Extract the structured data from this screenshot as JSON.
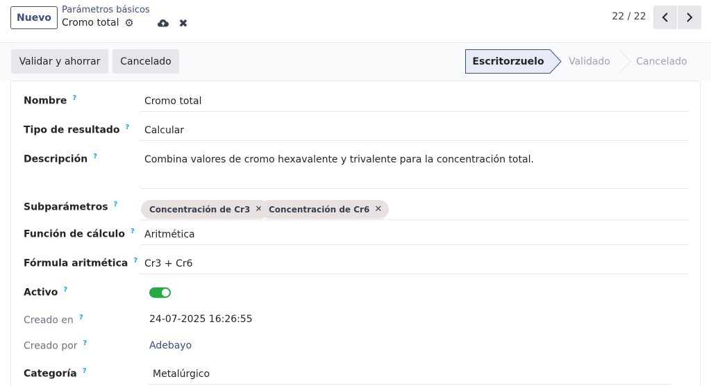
{
  "control_panel": {
    "new_button": "Nuevo",
    "breadcrumb_parent": "Parámetros básicos",
    "breadcrumb_current": "Cromo total",
    "pager_value": "22 / 22"
  },
  "statusbar": {
    "actions": [
      "Validar y ahorrar",
      "Cancelado"
    ],
    "stages": [
      "Escritorzuelo",
      "Validado",
      "Cancelado"
    ],
    "active_stage": "Escritorzuelo"
  },
  "form": {
    "help_mark": "?",
    "nombre": {
      "label": "Nombre",
      "value": "Cromo total"
    },
    "tipo_resultado": {
      "label": "Tipo de resultado",
      "value": "Calcular"
    },
    "descripcion": {
      "label": "Descripción",
      "value": "Combina valores de cromo hexavalente y trivalente para la concentración total."
    },
    "subparametros": {
      "label": "Subparámetros",
      "tags": [
        "Concentración de Cr3",
        "Concentración de Cr6"
      ]
    },
    "funcion_calculo": {
      "label": "Función de cálculo",
      "value": "Aritmética"
    },
    "formula_aritmetica": {
      "label": "Fórmula aritmética",
      "value": "Cr3 + Cr6"
    },
    "activo": {
      "label": "Activo",
      "value": true
    },
    "creado_en": {
      "label": "Creado en",
      "value": "24-07-2025 16:26:55"
    },
    "creado_por": {
      "label": "Creado por",
      "value": "Adebayo"
    },
    "categoria": {
      "label": "Categoría",
      "value": "Metalúrgico"
    }
  },
  "colors": {
    "primary": "#3b4d83",
    "active_stage_bg": "#e8ebf5",
    "toggle_on": "#28a745",
    "help": "#0ea5e9",
    "tag_bg": "#e7e1e0"
  }
}
